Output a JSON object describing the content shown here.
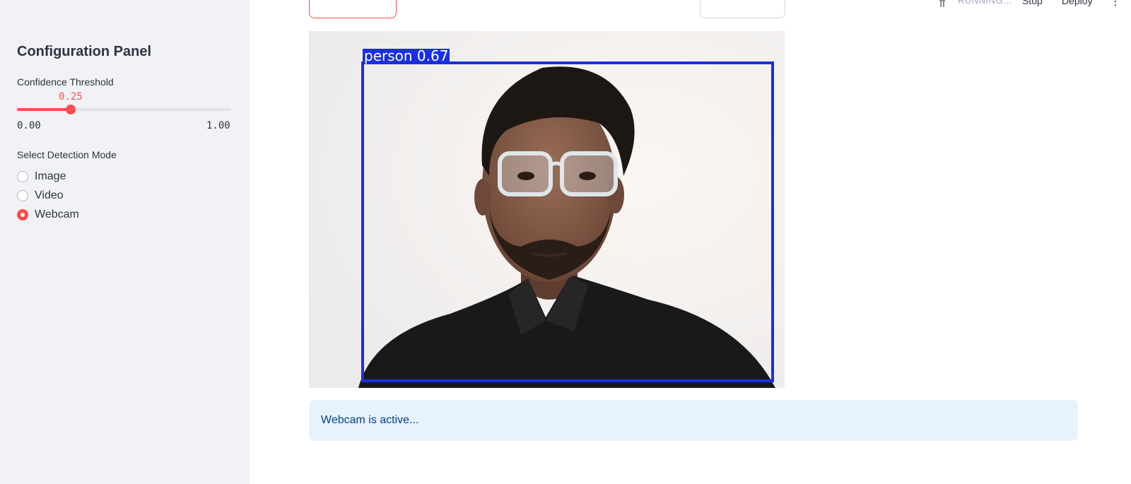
{
  "sidebar": {
    "title": "Configuration Panel",
    "confidence": {
      "label": "Confidence Threshold",
      "value": 0.25,
      "value_text": "0.25",
      "min_text": "0.00",
      "max_text": "1.00"
    },
    "mode": {
      "label": "Select Detection Mode",
      "options": [
        "Image",
        "Video",
        "Webcam"
      ],
      "selected": "Webcam"
    }
  },
  "toolbar": {
    "status": "RUNNING...",
    "stop_label": "Stop",
    "deploy_label": "Deploy",
    "menu_icon": "more-vert-icon"
  },
  "detection": {
    "label": "person 0.67",
    "box_color": "#1a2fe0"
  },
  "info": {
    "message": "Webcam is active..."
  },
  "colors": {
    "accent": "#ff4b4b",
    "sidebar_bg": "#f0f2f6",
    "info_bg": "#e8f2fc",
    "info_text": "#004280"
  }
}
